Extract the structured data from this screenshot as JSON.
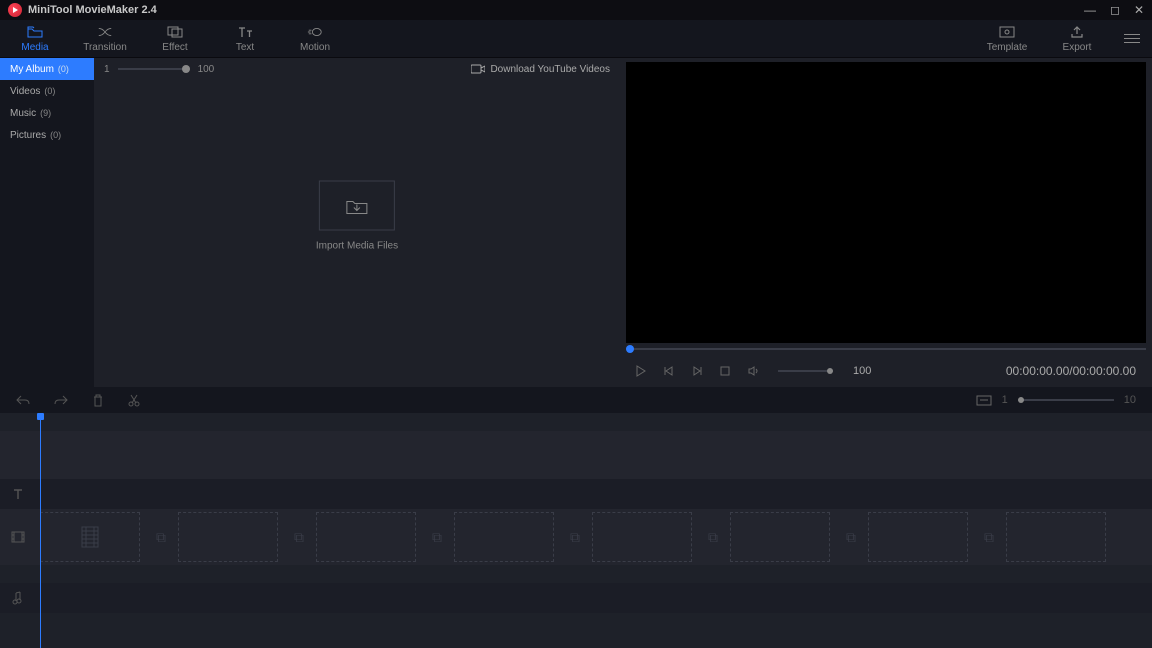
{
  "title": "MiniTool MovieMaker 2.4",
  "tools": {
    "media": "Media",
    "transition": "Transition",
    "effect": "Effect",
    "text": "Text",
    "motion": "Motion",
    "template": "Template",
    "export": "Export"
  },
  "sidebar": {
    "items": [
      {
        "label": "My Album",
        "count": "(0)",
        "active": true
      },
      {
        "label": "Videos",
        "count": "(0)",
        "active": false
      },
      {
        "label": "Music",
        "count": "(9)",
        "active": false
      },
      {
        "label": "Pictures",
        "count": "(0)",
        "active": false
      }
    ]
  },
  "media": {
    "zoom_min": "1",
    "zoom_max": "100",
    "download": "Download YouTube Videos",
    "import": "Import Media Files"
  },
  "player": {
    "volume": "100",
    "timecode": "00:00:00.00/00:00:00.00"
  },
  "timeline": {
    "zoom_min": "1",
    "zoom_max": "10"
  }
}
